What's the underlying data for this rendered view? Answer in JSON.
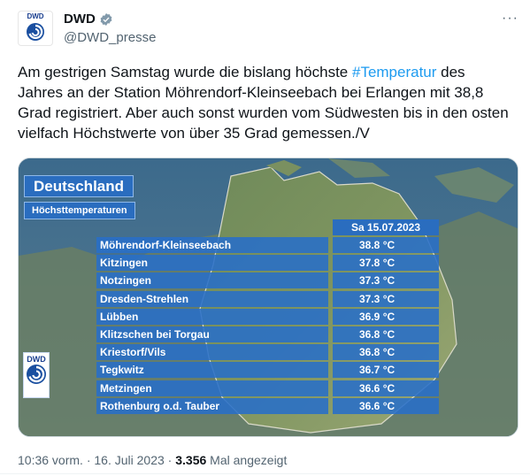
{
  "author": {
    "name": "DWD",
    "handle": "@DWD_presse",
    "avatar_label": "DWD",
    "verified_icon": "verified-badge-icon",
    "more_label": "···"
  },
  "tweet": {
    "text_before": "Am gestrigen Samstag wurde die bislang höchste ",
    "hashtag": "#Temperatur",
    "text_after": " des Jahres an der Station Möhrendorf-Kleinseebach bei Erlangen mit 38,8 Grad registriert. Aber auch sonst wurden vom Südwesten bis in den osten vielfach Höchstwerte von über 35 Grad gemessen./V"
  },
  "media": {
    "title": "Deutschland",
    "subtitle": "Höchsttemperaturen",
    "date": "Sa 15.07.2023",
    "logo_label": "DWD",
    "stations": [
      {
        "name": "Möhrendorf-Kleinseebach",
        "temp": "38.8 °C"
      },
      {
        "name": "Kitzingen",
        "temp": "37.8 °C"
      },
      {
        "name": "Notzingen",
        "temp": "37.3 °C"
      },
      {
        "name": "Dresden-Strehlen",
        "temp": "37.3 °C"
      },
      {
        "name": "Lübben",
        "temp": "36.9 °C"
      },
      {
        "name": "Klitzschen bei Torgau",
        "temp": "36.8 °C"
      },
      {
        "name": "Kriestorf/Vils",
        "temp": "36.8 °C"
      },
      {
        "name": "Tegkwitz",
        "temp": "36.7 °C"
      },
      {
        "name": "Metzingen",
        "temp": "36.6 °C"
      },
      {
        "name": "Rothenburg o.d. Tauber",
        "temp": "36.6 °C"
      }
    ]
  },
  "footer": {
    "time": "10:36 vorm.",
    "separator": " · ",
    "date": "16. Juli 2023",
    "views_count": "3.356",
    "views_label": " Mal angezeigt"
  },
  "colors": {
    "hashtag": "#1d9bf0",
    "panel_blue": "#2a6dbf",
    "verified": "#829aab"
  }
}
